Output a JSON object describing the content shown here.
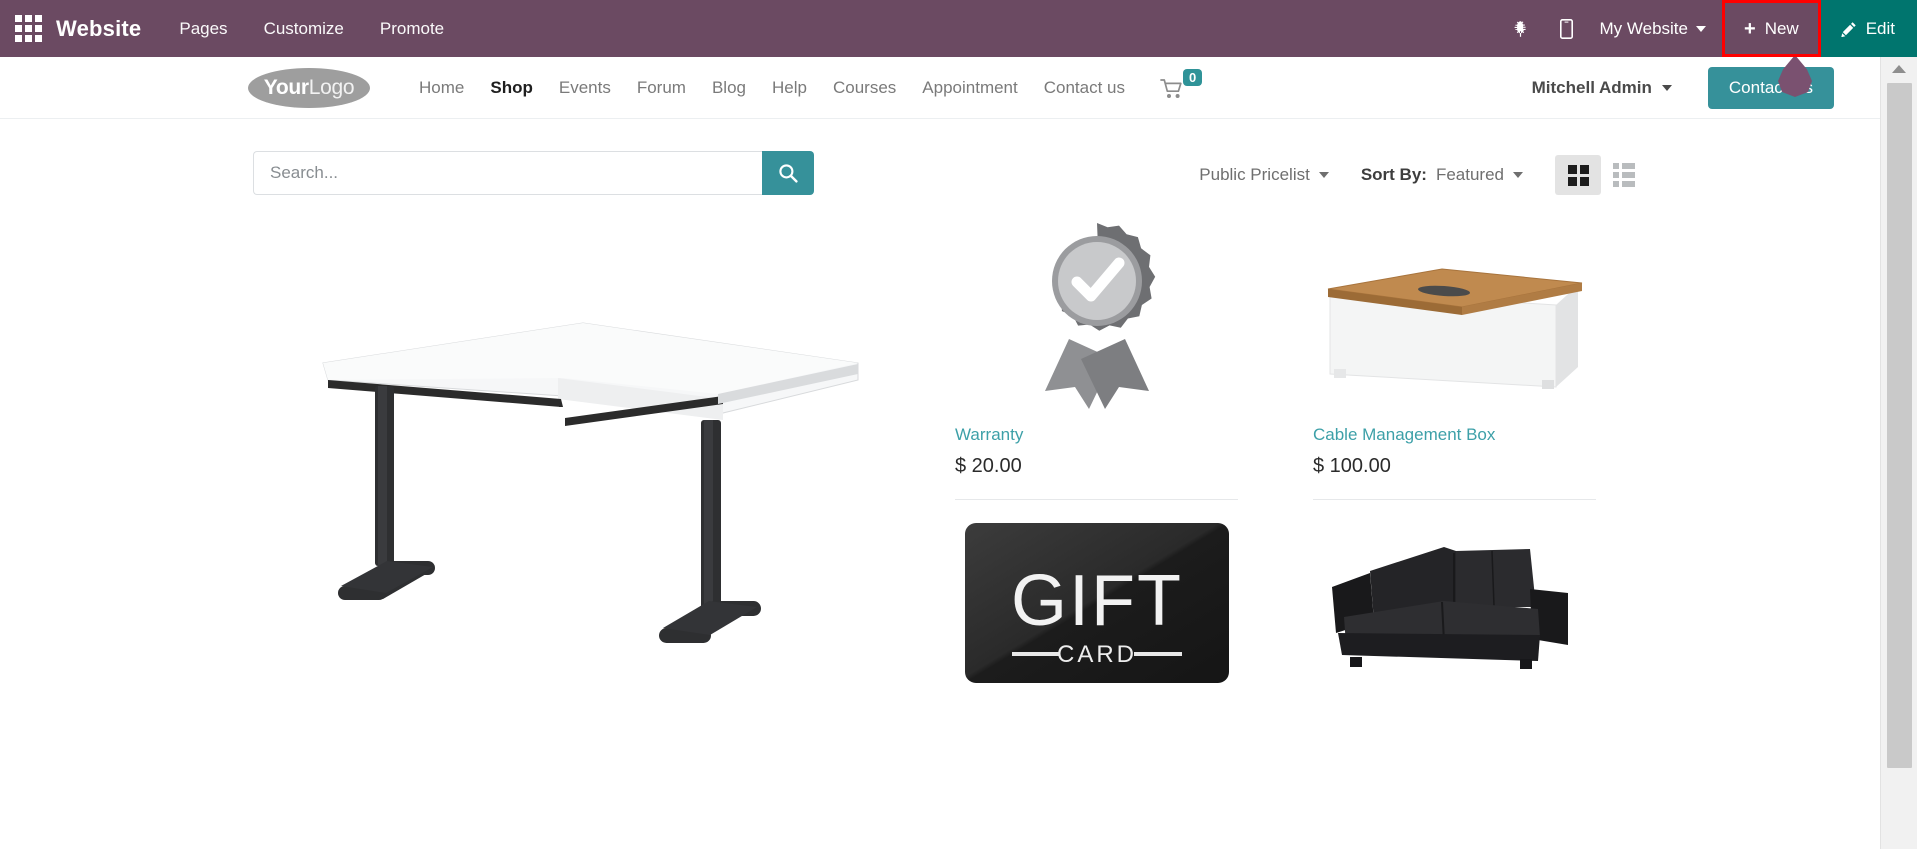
{
  "odoo_topbar": {
    "apps_icon": "apps-grid-icon",
    "app_name": "Website",
    "menu": [
      {
        "label": "Pages"
      },
      {
        "label": "Customize"
      },
      {
        "label": "Promote"
      }
    ],
    "bug_icon": "bug-icon",
    "mobile_icon": "mobile-preview-icon",
    "my_website_label": "My Website",
    "new_label": "New",
    "new_plus": "+",
    "edit_label": "Edit",
    "edit_icon": "pencil-icon",
    "bar_color": "#6b4a62",
    "edit_bg_color": "#00756e",
    "highlight_color": "#fe0000",
    "highlighted_element": "New"
  },
  "site_header": {
    "logo": {
      "bold": "Your",
      "light": "Logo"
    },
    "nav": [
      {
        "label": "Home",
        "active": false
      },
      {
        "label": "Shop",
        "active": true
      },
      {
        "label": "Events",
        "active": false
      },
      {
        "label": "Forum",
        "active": false
      },
      {
        "label": "Blog",
        "active": false
      },
      {
        "label": "Help",
        "active": false
      },
      {
        "label": "Courses",
        "active": false
      },
      {
        "label": "Appointment",
        "active": false
      },
      {
        "label": "Contact us",
        "active": false
      }
    ],
    "cart": {
      "icon": "shopping-cart-icon",
      "count": "0",
      "badge_color": "#2f9398"
    },
    "user_name": "Mitchell Admin",
    "contact_us_label": "Contact Us",
    "contact_us_color": "#36919a"
  },
  "toolbar": {
    "search_placeholder": "Search...",
    "search_value": "",
    "search_icon": "search-icon",
    "pricelist_label": "Public Pricelist",
    "sort_label": "Sort By:",
    "sort_value": "Featured",
    "grid_view_icon": "grid-view-icon",
    "list_view_icon": "list-view-icon",
    "active_view": "grid"
  },
  "products": {
    "featured": {
      "name": "Corner Desk",
      "image": "white-corner-desk-black-legs"
    },
    "items": [
      {
        "name": "Warranty",
        "price": "$ 20.00",
        "image": "gray-award-badge-checkmark"
      },
      {
        "name": "Cable Management Box",
        "price": "$ 100.00",
        "image": "white-box-wooden-lid"
      },
      {
        "name": "",
        "price": "",
        "image": "black-gift-card"
      },
      {
        "name": "",
        "price": "",
        "image": "black-leather-sofa"
      }
    ],
    "gift_card_text": {
      "main": "GIFT",
      "sub": "CARD"
    }
  },
  "scrollbar": {
    "up_arrow_icon": "scroll-up-arrow-icon",
    "thumb": "scroll-thumb"
  }
}
